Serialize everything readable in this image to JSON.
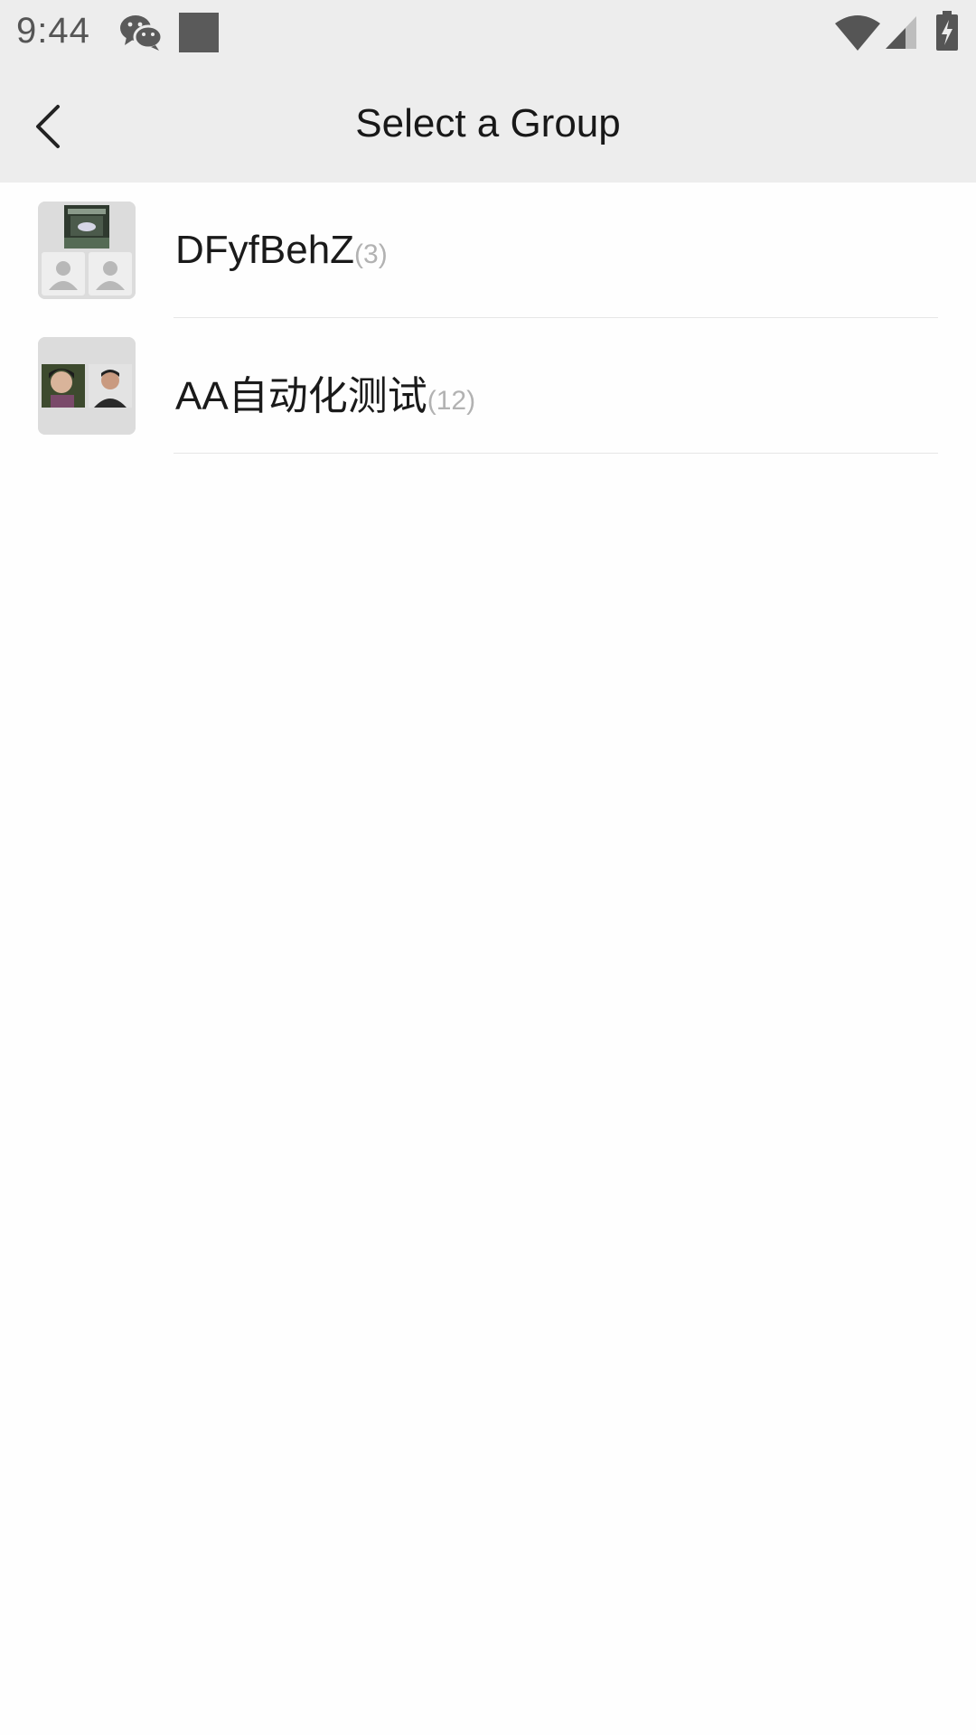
{
  "status_bar": {
    "time": "9:44",
    "icons": [
      "wechat-icon",
      "notification-square-icon",
      "wifi-icon",
      "cellular-signal-icon",
      "battery-charging-icon"
    ]
  },
  "header": {
    "title": "Select a Group",
    "back_icon": "chevron-left-icon"
  },
  "groups": [
    {
      "name": "DFyfBehZ",
      "count": "(3)"
    },
    {
      "name": "AA自动化测试",
      "count": "(12)"
    }
  ],
  "colors": {
    "bar_background": "#ededed",
    "page_background": "#fefefe",
    "title_text": "#181818",
    "count_text": "#b2b2b2"
  }
}
